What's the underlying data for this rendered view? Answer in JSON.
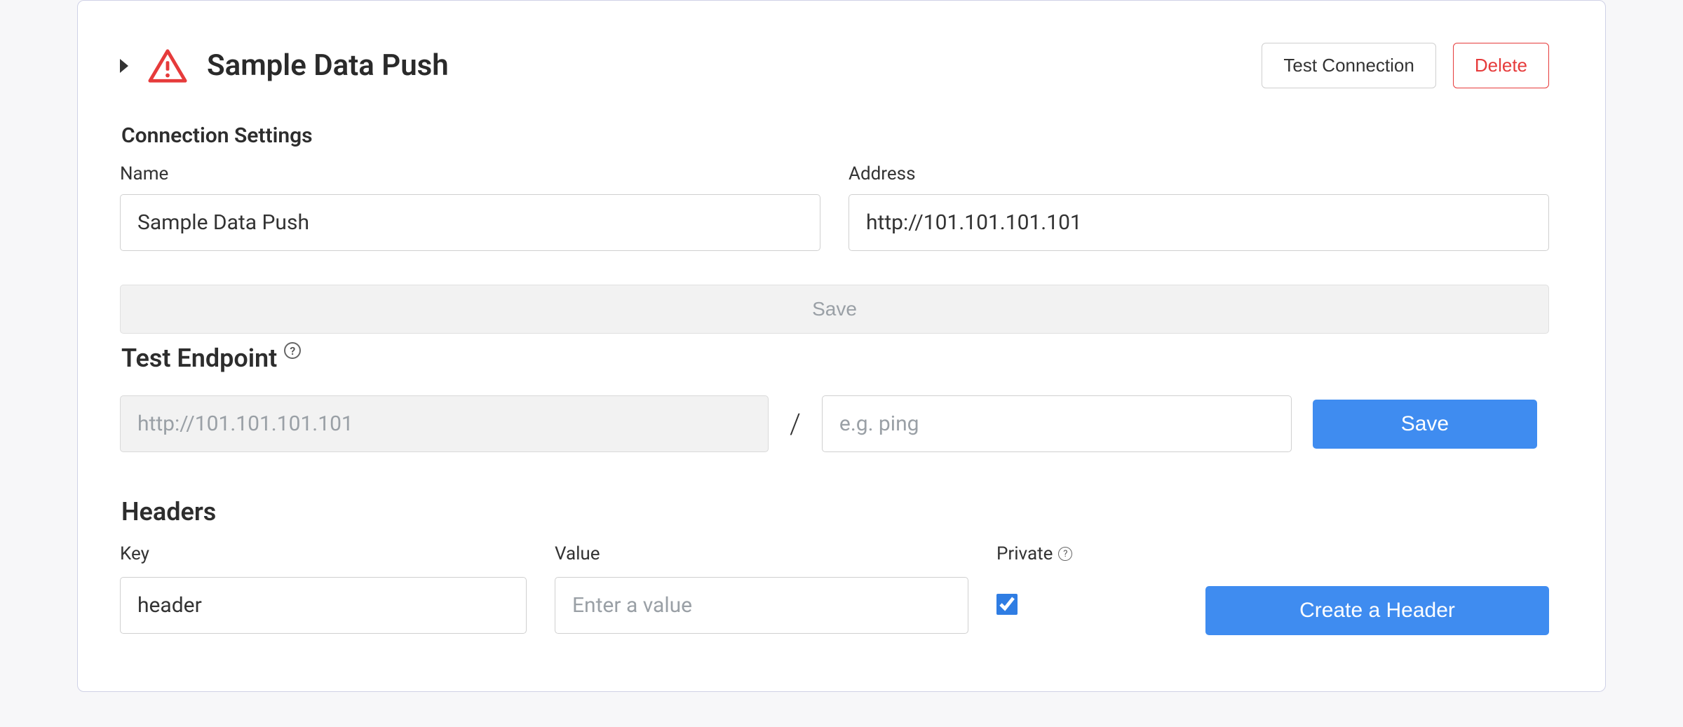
{
  "header": {
    "title": "Sample Data Push",
    "test_connection_label": "Test Connection",
    "delete_label": "Delete"
  },
  "connection": {
    "section_label": "Connection Settings",
    "name_label": "Name",
    "name_value": "Sample Data Push",
    "address_label": "Address",
    "address_value": "http://101.101.101.101",
    "save_label": "Save"
  },
  "test_endpoint": {
    "section_label": "Test Endpoint",
    "base_value": "http://101.101.101.101",
    "path_placeholder": "e.g. ping",
    "path_value": "",
    "save_label": "Save",
    "separator": "/"
  },
  "headers": {
    "section_label": "Headers",
    "key_label": "Key",
    "key_value": "header",
    "value_label": "Value",
    "value_placeholder": "Enter a value",
    "value_value": "",
    "private_label": "Private",
    "private_checked": true,
    "create_label": "Create a Header"
  }
}
